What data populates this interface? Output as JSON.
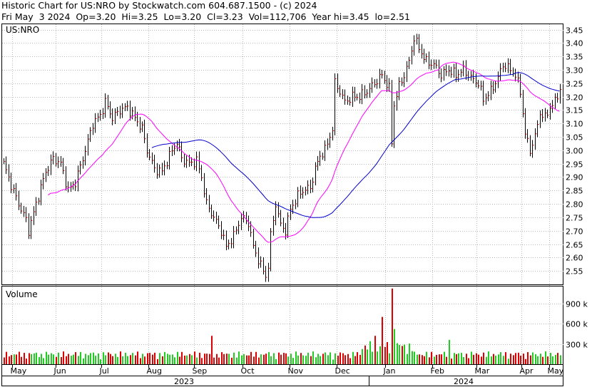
{
  "header": {
    "line1": "Historic Chart for US:NRO by Stockwatch.com 604.687.1500 - (c) 2024",
    "line2": "Fri May  3 2024  Op=3.20  Hi=3.25  Lo=3.20  Cl=3.23  Vol=112,706  Year hi=3.45  lo=2.51"
  },
  "colors": {
    "bar_high_low": "#000000",
    "bar_close_tick": "#cc0000",
    "ma_short": "#ff00ff",
    "ma_long": "#0000cc",
    "volume_bar": "#dd0000",
    "volume_bar_alt": "#22cc22",
    "grid": "#b8b8b8"
  },
  "chart_data": [
    {
      "type": "ohlc",
      "panel": "price",
      "symbol_label": "US:NRO",
      "ylim": [
        2.5,
        3.47
      ],
      "y_ticks": [
        "3.45",
        "3.40",
        "3.35",
        "3.30",
        "3.25",
        "3.20",
        "3.15",
        "3.10",
        "3.05",
        "3.00",
        "2.95",
        "2.90",
        "2.85",
        "2.80",
        "2.75",
        "2.70",
        "2.65",
        "2.60",
        "2.55"
      ],
      "x_months": [
        "May",
        "Jun",
        "Jul",
        "Aug",
        "Sep",
        "Oct",
        "Nov",
        "Dec",
        "Jan",
        "Feb",
        "Mar",
        "Apr",
        "May"
      ],
      "x_years": [
        "2023",
        "2024"
      ],
      "grid": true,
      "close_anchors": [
        [
          0,
          2.95
        ],
        [
          3,
          2.87
        ],
        [
          6,
          2.8
        ],
        [
          9,
          2.74
        ],
        [
          10,
          2.7
        ],
        [
          13,
          2.8
        ],
        [
          17,
          2.92
        ],
        [
          20,
          2.97
        ],
        [
          23,
          2.95
        ],
        [
          26,
          2.85
        ],
        [
          29,
          2.88
        ],
        [
          33,
          3.0
        ],
        [
          36,
          3.1
        ],
        [
          39,
          3.13
        ],
        [
          41,
          3.18
        ],
        [
          44,
          3.12
        ],
        [
          47,
          3.15
        ],
        [
          50,
          3.16
        ],
        [
          53,
          3.12
        ],
        [
          56,
          3.08
        ],
        [
          58,
          3.0
        ],
        [
          61,
          2.93
        ],
        [
          64,
          2.92
        ],
        [
          67,
          2.98
        ],
        [
          70,
          3.03
        ],
        [
          72,
          2.97
        ],
        [
          75,
          2.95
        ],
        [
          78,
          2.96
        ],
        [
          80,
          2.9
        ],
        [
          82,
          2.8
        ],
        [
          85,
          2.75
        ],
        [
          88,
          2.7
        ],
        [
          90,
          2.64
        ],
        [
          93,
          2.68
        ],
        [
          96,
          2.75
        ],
        [
          99,
          2.73
        ],
        [
          101,
          2.64
        ],
        [
          104,
          2.57
        ],
        [
          106,
          2.53
        ],
        [
          107,
          2.57
        ],
        [
          108,
          2.68
        ],
        [
          110,
          2.8
        ],
        [
          112,
          2.72
        ],
        [
          114,
          2.7
        ],
        [
          116,
          2.78
        ],
        [
          119,
          2.83
        ],
        [
          121,
          2.85
        ],
        [
          124,
          2.86
        ],
        [
          126,
          2.93
        ],
        [
          128,
          2.98
        ],
        [
          130,
          3.0
        ],
        [
          133,
          3.08
        ],
        [
          134,
          3.25
        ],
        [
          136,
          3.22
        ],
        [
          138,
          3.18
        ],
        [
          141,
          3.2
        ],
        [
          144,
          3.2
        ],
        [
          147,
          3.22
        ],
        [
          150,
          3.25
        ],
        [
          153,
          3.28
        ],
        [
          156,
          3.23
        ],
        [
          157,
          3.03
        ],
        [
          158,
          3.17
        ],
        [
          160,
          3.24
        ],
        [
          162,
          3.28
        ],
        [
          164,
          3.33
        ],
        [
          166,
          3.42
        ],
        [
          168,
          3.38
        ],
        [
          171,
          3.33
        ],
        [
          174,
          3.32
        ],
        [
          177,
          3.28
        ],
        [
          180,
          3.3
        ],
        [
          183,
          3.28
        ],
        [
          186,
          3.3
        ],
        [
          189,
          3.27
        ],
        [
          192,
          3.25
        ],
        [
          194,
          3.19
        ],
        [
          197,
          3.22
        ],
        [
          200,
          3.27
        ],
        [
          202,
          3.32
        ],
        [
          205,
          3.3
        ],
        [
          207,
          3.28
        ],
        [
          209,
          3.22
        ],
        [
          211,
          3.06
        ],
        [
          213,
          3.0
        ],
        [
          215,
          3.05
        ],
        [
          217,
          3.14
        ],
        [
          219,
          3.12
        ],
        [
          221,
          3.16
        ],
        [
          223,
          3.18
        ],
        [
          225,
          3.23
        ]
      ]
    },
    {
      "type": "bar",
      "panel": "volume",
      "title": "Volume",
      "ylim": [
        0,
        1150000
      ],
      "y_ticks": [
        "900 k",
        "600 k",
        "300 k"
      ],
      "spikes": [
        [
          84,
          420000
        ],
        [
          150,
          420000
        ],
        [
          153,
          700000
        ],
        [
          157,
          1120000
        ],
        [
          158,
          520000
        ],
        [
          180,
          360000
        ]
      ]
    }
  ]
}
